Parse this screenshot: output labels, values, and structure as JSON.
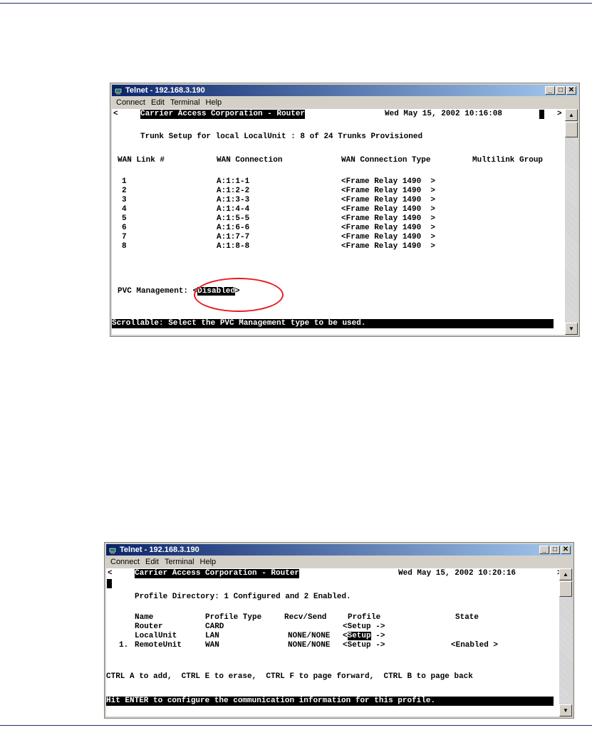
{
  "window1": {
    "title": "Telnet - 192.168.3.190",
    "menu": [
      "Connect",
      "Edit",
      "Terminal",
      "Help"
    ],
    "header_left": "<",
    "header_title": "Carrier Access Corporation - Router",
    "header_datetime": "Wed May 15, 2002 10:16:08",
    "header_right": ">",
    "subtitle": "Trunk Setup for local LocalUnit : 8 of 24 Trunks Provisioned",
    "columns": [
      "WAN Link #",
      "WAN Connection",
      "WAN Connection Type",
      "Multilink Group"
    ],
    "rows": [
      {
        "link": "1",
        "conn": "A:1:1-1",
        "type": "<Frame Relay 1490  >"
      },
      {
        "link": "2",
        "conn": "A:1:2-2",
        "type": "<Frame Relay 1490  >"
      },
      {
        "link": "3",
        "conn": "A:1:3-3",
        "type": "<Frame Relay 1490  >"
      },
      {
        "link": "4",
        "conn": "A:1:4-4",
        "type": "<Frame Relay 1490  >"
      },
      {
        "link": "5",
        "conn": "A:1:5-5",
        "type": "<Frame Relay 1490  >"
      },
      {
        "link": "6",
        "conn": "A:1:6-6",
        "type": "<Frame Relay 1490  >"
      },
      {
        "link": "7",
        "conn": "A:1:7-7",
        "type": "<Frame Relay 1490  >"
      },
      {
        "link": "8",
        "conn": "A:1:8-8",
        "type": "<Frame Relay 1490  >"
      }
    ],
    "pvc_label": "PVC Management: ",
    "pvc_open": "<",
    "pvc_value": "Disabled",
    "pvc_close": ">",
    "status": "Scrollable: Select the PVC Management type to be used."
  },
  "window2": {
    "title": "Telnet - 192.168.3.190",
    "menu": [
      "Connect",
      "Edit",
      "Terminal",
      "Help"
    ],
    "header_left": "<",
    "header_title": "Carrier Access Corporation - Router",
    "header_datetime": "Wed May 15, 2002 10:20:16",
    "header_right": ">",
    "subtitle": "Profile Directory: 1 Configured and 2 Enabled.",
    "columns": [
      "Name",
      "Profile Type",
      "Recv/Send",
      "Profile",
      "State"
    ],
    "rows": [
      {
        "num": "",
        "name": "Router",
        "ptype": "CARD",
        "rs": "",
        "profile_open": "<",
        "profile": "Setup",
        "profile_close": " ->",
        "state": ""
      },
      {
        "num": "",
        "name": "LocalUnit",
        "ptype": "LAN",
        "rs": "NONE/NONE",
        "profile_open": "<",
        "profile": "Setup",
        "profile_close": " ->",
        "state": ""
      },
      {
        "num": "1.",
        "name": "RemoteUnit",
        "ptype": "WAN",
        "rs": "NONE/NONE",
        "profile_open": "<",
        "profile": "Setup",
        "profile_close": " ->",
        "state": "<Enabled >"
      }
    ],
    "help": "CTRL A to add,  CTRL E to erase,  CTRL F to page forward,  CTRL B to page back",
    "status": "Hit ENTER to configure the communication information for this profile."
  },
  "colors": {
    "titlebar_start": "#0a246a",
    "titlebar_end": "#a6caf0",
    "annotation_circle": "#e8191f",
    "rule": "#1f2a6b"
  }
}
